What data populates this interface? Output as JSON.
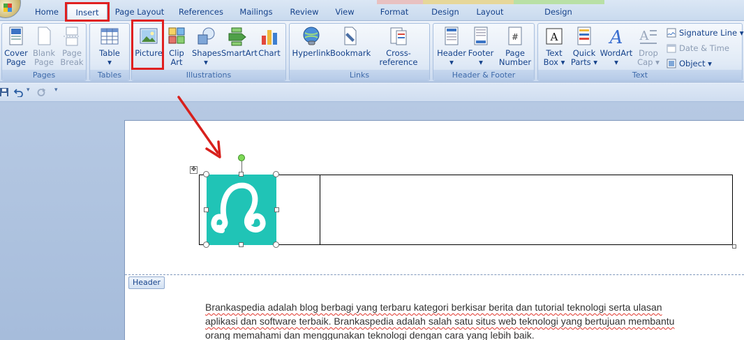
{
  "tabs": [
    "Home",
    "Insert",
    "Page Layout",
    "References",
    "Mailings",
    "Review",
    "View",
    "Format",
    "Design",
    "Layout",
    "Design"
  ],
  "active_tab": "Insert",
  "context_colors": {
    "format_band": "#e8c1c1",
    "table_band": "#e6d79a",
    "header_band": "#b9e0a6"
  },
  "ribbon": {
    "pages": {
      "label": "Pages",
      "cover_page": "Cover Page",
      "blank_page": "Blank Page",
      "page_break": "Page Break"
    },
    "tables": {
      "label": "Tables",
      "table": "Table"
    },
    "illustrations": {
      "label": "Illustrations",
      "picture": "Picture",
      "clip_art": "Clip Art",
      "shapes": "Shapes",
      "smartart": "SmartArt",
      "chart": "Chart"
    },
    "links": {
      "label": "Links",
      "hyperlink": "Hyperlink",
      "bookmark": "Bookmark",
      "cross_reference": "Cross-reference"
    },
    "header_footer": {
      "label": "Header & Footer",
      "header": "Header",
      "footer": "Footer",
      "page_number": "Page Number"
    },
    "text": {
      "label": "Text",
      "text_box": "Text Box",
      "quick_parts": "Quick Parts",
      "wordart": "WordArt",
      "drop_cap": "Drop Cap",
      "signature_line": "Signature Line",
      "date_time": "Date & Time",
      "object": "Object"
    }
  },
  "document": {
    "header_label": "Header",
    "body_lines": [
      "Brankaspedia adalah blog berbagi yang terbaru kategori berkisar berita dan tutorial teknologi serta ulasan",
      "aplikasi dan software terbaik. Brankaspedia adalah salah satu situs web teknologi yang bertujuan membantu",
      "orang memahami dan menggunakan teknologi dengan cara yang lebih baik."
    ]
  }
}
